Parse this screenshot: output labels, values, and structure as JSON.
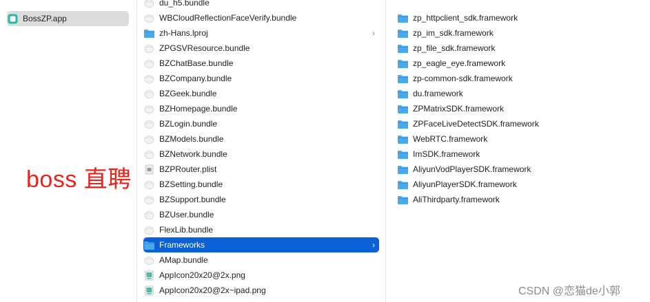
{
  "sidebar": {
    "items": [
      {
        "label": "BossZP.app",
        "icon": "app-icon",
        "selected": true
      }
    ]
  },
  "bundle_column": {
    "items": [
      {
        "label": "du_h5.bundle",
        "icon": "bundle-icon"
      },
      {
        "label": "WBCloudReflectionFaceVerify.bundle",
        "icon": "bundle-icon"
      },
      {
        "label": "zh-Hans.lproj",
        "icon": "folder-icon",
        "has_children": true
      },
      {
        "label": "ZPGSVResource.bundle",
        "icon": "bundle-icon"
      },
      {
        "label": "BZChatBase.bundle",
        "icon": "bundle-icon"
      },
      {
        "label": "BZCompany.bundle",
        "icon": "bundle-icon"
      },
      {
        "label": "BZGeek.bundle",
        "icon": "bundle-icon"
      },
      {
        "label": "BZHomepage.bundle",
        "icon": "bundle-icon"
      },
      {
        "label": "BZLogin.bundle",
        "icon": "bundle-icon"
      },
      {
        "label": "BZModels.bundle",
        "icon": "bundle-icon"
      },
      {
        "label": "BZNetwork.bundle",
        "icon": "bundle-icon"
      },
      {
        "label": "BZPRouter.plist",
        "icon": "plist-icon"
      },
      {
        "label": "BZSetting.bundle",
        "icon": "bundle-icon"
      },
      {
        "label": "BZSupport.bundle",
        "icon": "bundle-icon"
      },
      {
        "label": "BZUser.bundle",
        "icon": "bundle-icon"
      },
      {
        "label": "FlexLib.bundle",
        "icon": "bundle-icon"
      },
      {
        "label": "Frameworks",
        "icon": "folder-icon",
        "has_children": true,
        "selected": true
      },
      {
        "label": "AMap.bundle",
        "icon": "bundle-icon"
      },
      {
        "label": "AppIcon20x20@2x.png",
        "icon": "png-icon"
      },
      {
        "label": "AppIcon20x20@2x~ipad.png",
        "icon": "png-icon"
      }
    ]
  },
  "frameworks_column": {
    "items": [
      {
        "label": "zp_httpclient_sdk.framework",
        "icon": "folder-icon"
      },
      {
        "label": "zp_im_sdk.framework",
        "icon": "folder-icon"
      },
      {
        "label": "zp_file_sdk.framework",
        "icon": "folder-icon"
      },
      {
        "label": "zp_eagle_eye.framework",
        "icon": "folder-icon"
      },
      {
        "label": "zp-common-sdk.framework",
        "icon": "folder-icon"
      },
      {
        "label": "du.framework",
        "icon": "folder-icon"
      },
      {
        "label": "ZPMatrixSDK.framework",
        "icon": "folder-icon"
      },
      {
        "label": "ZPFaceLiveDetectSDK.framework",
        "icon": "folder-icon"
      },
      {
        "label": "WebRTC.framework",
        "icon": "folder-icon"
      },
      {
        "label": "ImSDK.framework",
        "icon": "folder-icon"
      },
      {
        "label": "AliyunVodPlayerSDK.framework",
        "icon": "folder-icon"
      },
      {
        "label": "AliyunPlayerSDK.framework",
        "icon": "folder-icon"
      },
      {
        "label": "AliThirdparty.framework",
        "icon": "folder-icon"
      }
    ]
  },
  "overlay": {
    "big_text": "boss 直聘",
    "watermark": "CSDN @恋猫de小郭"
  },
  "colors": {
    "selection": "#0b61d6",
    "folder": "#4aa9ec",
    "annotation": "#e8231b"
  }
}
